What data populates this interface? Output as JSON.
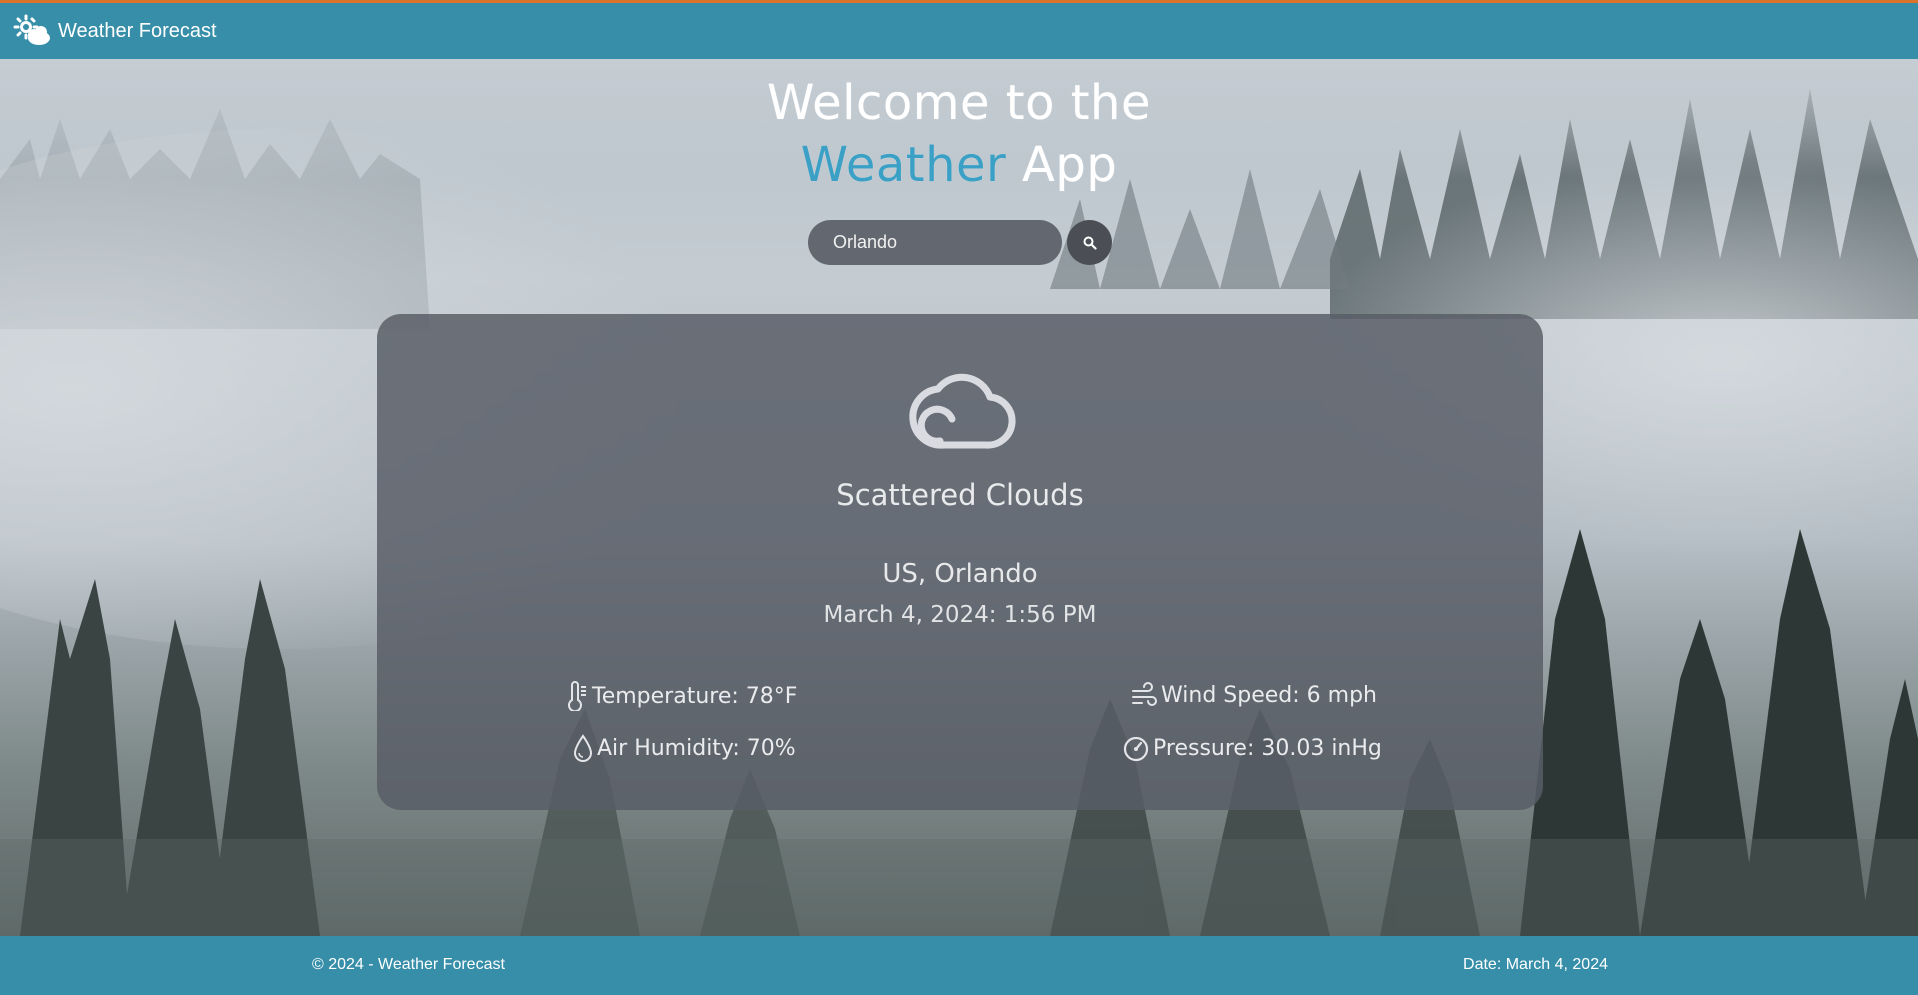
{
  "navbar": {
    "brand_icon": "cloud-sun-icon",
    "brand_label": "Weather Forecast"
  },
  "hero": {
    "line1": "Welcome to the",
    "line2_accent": "Weather",
    "line2_rest": " App"
  },
  "search": {
    "value": "Orlando",
    "button_icon": "search-icon"
  },
  "weather": {
    "condition_icon": "cloud-icon",
    "condition": "Scattered Clouds",
    "location": "US, Orlando",
    "datetime": "March 4, 2024: 1:56 PM",
    "stats": {
      "temperature": {
        "icon": "thermometer-icon",
        "label": "Temperature: 78°F"
      },
      "wind": {
        "icon": "wind-icon",
        "label": "Wind Speed: 6 mph"
      },
      "humidity": {
        "icon": "droplet-icon",
        "label": "Air Humidity: 70%"
      },
      "pressure": {
        "icon": "gauge-icon",
        "label": "Pressure: 30.03 inHg"
      }
    }
  },
  "footer": {
    "copyright": "© 2024 - Weather Forecast",
    "date": "Date: March 4, 2024"
  },
  "colors": {
    "brand": "#368ea8",
    "top_border": "#d9742b",
    "accent_text": "#3aa0c6",
    "card_bg": "#585d66"
  }
}
